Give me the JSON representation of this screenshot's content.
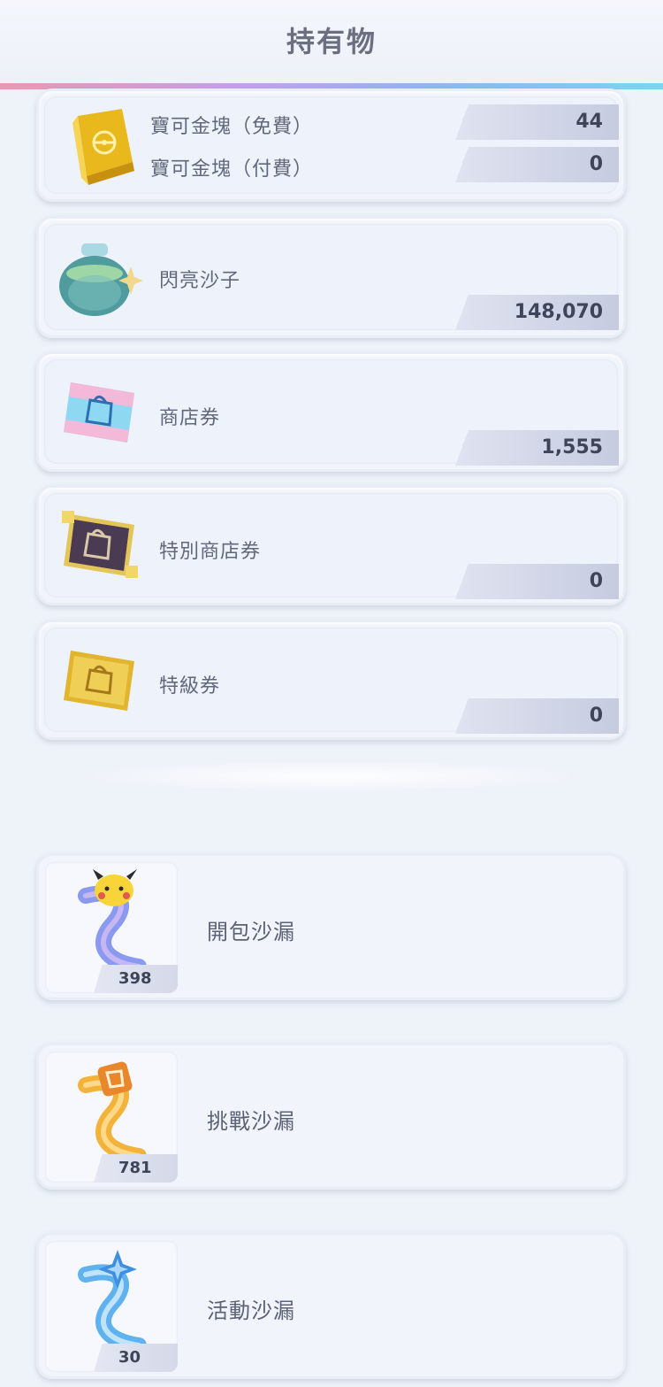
{
  "header": {
    "title": "持有物"
  },
  "currency": {
    "gold": {
      "free_label": "寶可金塊（免費）",
      "free_value": "44",
      "paid_label": "寶可金塊（付費）",
      "paid_value": "0",
      "icon": "gold-bar-icon"
    },
    "items": [
      {
        "label": "閃亮沙子",
        "value": "148,070",
        "icon": "shiny-sand-bottle-icon"
      },
      {
        "label": "商店券",
        "value": "1,555",
        "icon": "shop-ticket-icon"
      },
      {
        "label": "特別商店券",
        "value": "0",
        "icon": "special-shop-ticket-icon"
      },
      {
        "label": "特級券",
        "value": "0",
        "icon": "premium-ticket-icon"
      }
    ]
  },
  "hourglasses": [
    {
      "label": "開包沙漏",
      "count": "398",
      "icon": "pack-hourglass-icon",
      "color": "#8a9af0"
    },
    {
      "label": "挑戰沙漏",
      "count": "781",
      "icon": "challenge-hourglass-icon",
      "color": "#f3b23a"
    },
    {
      "label": "活動沙漏",
      "count": "30",
      "icon": "event-hourglass-icon",
      "color": "#5fb2ee"
    }
  ]
}
